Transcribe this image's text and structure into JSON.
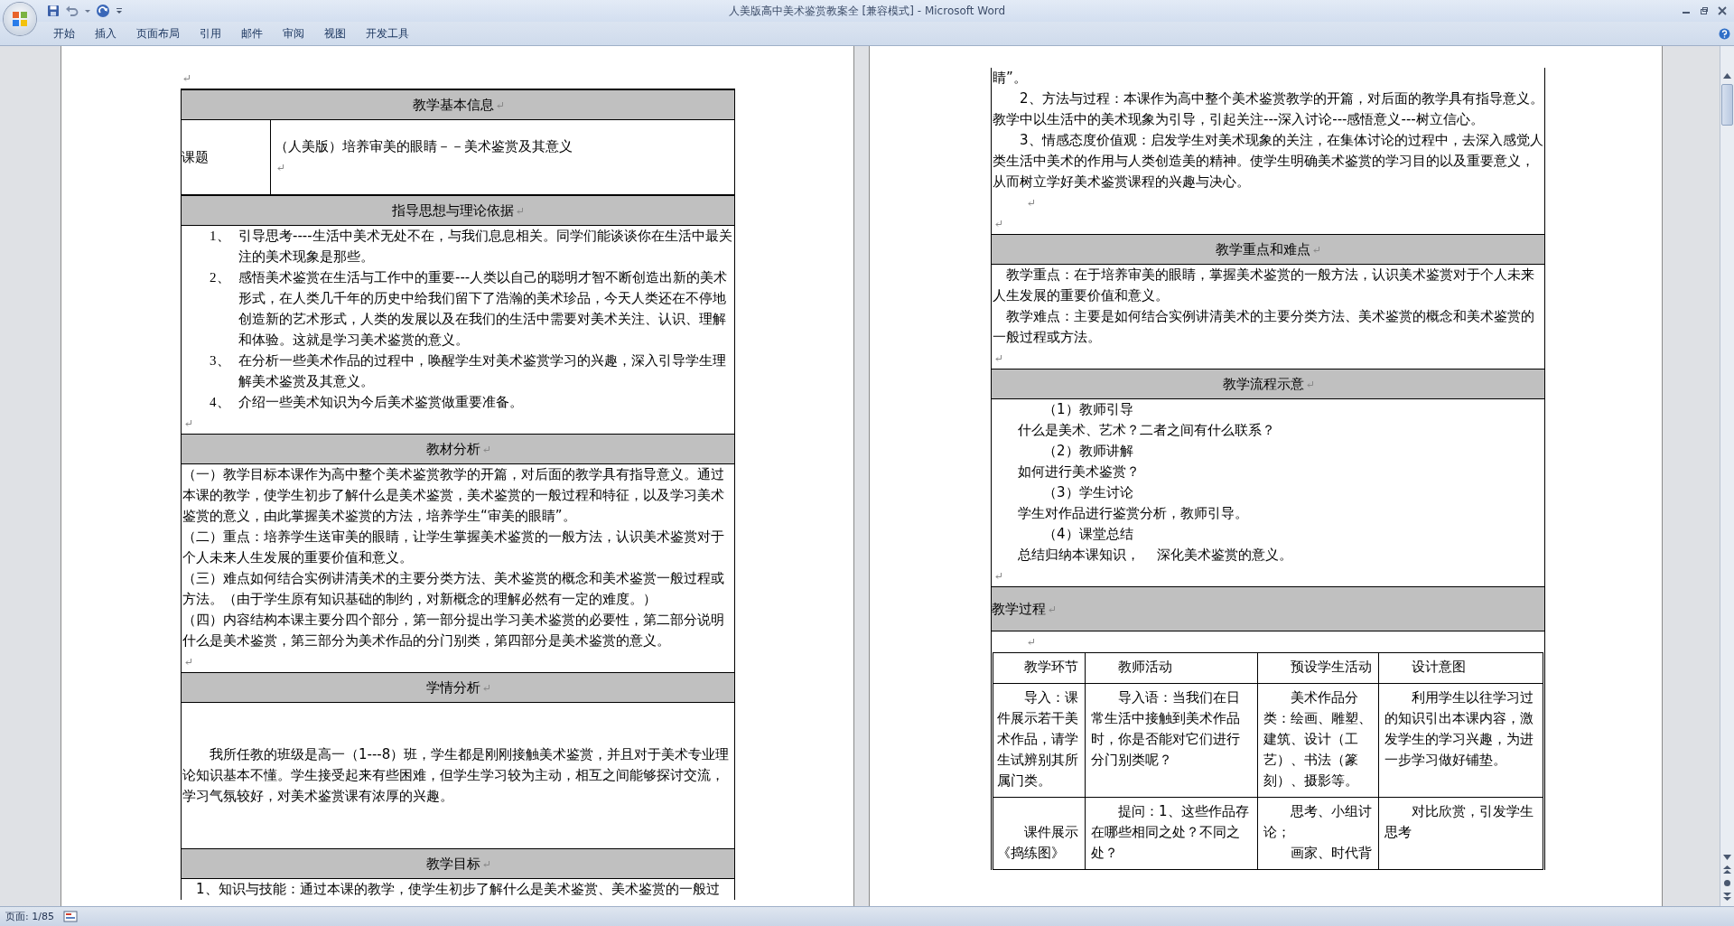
{
  "window": {
    "title": "人美版高中美术鉴赏教案全 [兼容模式] - Microsoft Word"
  },
  "ribbon_tabs": [
    {
      "label": "开始"
    },
    {
      "label": "插入"
    },
    {
      "label": "页面布局"
    },
    {
      "label": "引用"
    },
    {
      "label": "邮件"
    },
    {
      "label": "审阅"
    },
    {
      "label": "视图"
    },
    {
      "label": "开发工具"
    }
  ],
  "pages": [
    {
      "kind": "start",
      "sections": [
        {
          "kind": "header",
          "title": "教学基本信息"
        },
        {
          "kind": "label_row",
          "label": "课题",
          "paragraphs": [
            {
              "kind": "plain",
              "text": "（人美版）培养审美的眼睛－－美术鉴赏及其意义"
            },
            {
              "kind": "mark"
            }
          ]
        },
        {
          "kind": "header",
          "title": "指导思想与理论依据"
        },
        {
          "kind": "body",
          "paragraphs": [
            {
              "kind": "numbered",
              "number": "1、",
              "text": "引导思考----生活中美术无处不在，与我们息息相关。同学们能谈谈你在生活中最关注的美术现象是那些。"
            },
            {
              "kind": "numbered",
              "number": "2、",
              "text": "感悟美术鉴赏在生活与工作中的重要---人类以自己的聪明才智不断创造出新的美术形式，在人类几千年的历史中给我们留下了浩瀚的美术珍品，今天人类还在不停地创造新的艺术形式，人类的发展以及在我们的生活中需要对美术关注、认识、理解和体验。这就是学习美术鉴赏的意义。"
            },
            {
              "kind": "numbered",
              "number": "3、",
              "text": "在分析一些美术作品的过程中，唤醒学生对美术鉴赏学习的兴趣，深入引导学生理解美术鉴赏及其意义。"
            },
            {
              "kind": "numbered",
              "number": "4、",
              "text": "介绍一些美术知识为今后美术鉴赏做重要准备。"
            },
            {
              "kind": "mark"
            }
          ]
        },
        {
          "kind": "header",
          "title": "教材分析"
        },
        {
          "kind": "body",
          "paragraphs": [
            {
              "kind": "plain",
              "text": "（一）教学目标本课作为高中整个美术鉴赏教学的开篇，对后面的教学具有指导意义。通过本课的教学，使学生初步了解什么是美术鉴赏，美术鉴赏的一般过程和特征，以及学习美术鉴赏的意义，由此掌握美术鉴赏的方法，培养学生“审美的眼睛”。"
            },
            {
              "kind": "plain",
              "text": "（二）重点：培养学生送审美的眼睛，让学生掌握美术鉴赏的一般方法，认识美术鉴赏对于个人未来人生发展的重要价值和意义。"
            },
            {
              "kind": "plain",
              "text": "（三）难点如何结合实例讲清美术的主要分类方法、美术鉴赏的概念和美术鉴赏一般过程或方法。（由于学生原有知识基础的制约，对新概念的理解必然有一定的难度。）"
            },
            {
              "kind": "plain",
              "text": "（四）内容结构本课主要分四个部分，第一部分提出学习美术鉴赏的必要性，第二部分说明什么是美术鉴赏，第三部分为美术作品的分门别类，第四部分是美术鉴赏的意义。"
            },
            {
              "kind": "mark"
            }
          ]
        },
        {
          "kind": "header",
          "title": "学情分析"
        },
        {
          "kind": "body",
          "paragraphs": [
            {
              "kind": "gap"
            },
            {
              "kind": "gap"
            },
            {
              "kind": "first_line",
              "text": "我所任教的班级是高一（1---8）班，学生都是刚刚接触美术鉴赏，并且对于美术专业理论知识基本不懂。学生接受起来有些困难，但学生学习较为主动，相互之间能够探讨交流，学习气氛较好，对美术鉴赏课有浓厚的兴趣。"
            },
            {
              "kind": "gap"
            },
            {
              "kind": "gap"
            }
          ]
        },
        {
          "kind": "header",
          "title": "教学目标"
        },
        {
          "kind": "body",
          "paragraphs": [
            {
              "kind": "first_small",
              "text": "1、知识与技能：通过本课的教学，使学生初步了解什么是美术鉴赏、美术鉴赏的一般过"
            }
          ]
        }
      ]
    },
    {
      "kind": "continued",
      "sections": [
        {
          "kind": "body",
          "paragraphs": [
            {
              "kind": "plain",
              "text": "睛”。"
            },
            {
              "kind": "first_line",
              "text": "2、方法与过程：本课作为高中整个美术鉴赏教学的开篇，对后面的教学具有指导意义。教学中以生活中的美术现象为引导，引起关注---深入讨论---感悟意义---树立信心。"
            },
            {
              "kind": "first_line",
              "text": "3、情感态度价值观：启发学生对美术现象的关注，在集体讨论的过程中，去深入感觉人类生活中美术的作用与人类创造美的精神。使学生明确美术鉴赏的学习目的以及重要意义，从而树立学好美术鉴赏课程的兴趣与决心。"
            },
            {
              "kind": "indent_mark"
            },
            {
              "kind": "mark"
            }
          ]
        },
        {
          "kind": "header",
          "title": "教学重点和难点"
        },
        {
          "kind": "body",
          "paragraphs": [
            {
              "kind": "first_small",
              "text": "教学重点：在于培养审美的眼睛，掌握美术鉴赏的一般方法，认识美术鉴赏对于个人未来人生发展的重要价值和意义。"
            },
            {
              "kind": "first_small",
              "text": "教学难点：主要是如何结合实例讲清美术的主要分类方法、美术鉴赏的概念和美术鉴赏的一般过程或方法。"
            },
            {
              "kind": "mark"
            }
          ]
        },
        {
          "kind": "header",
          "title": "教学流程示意"
        },
        {
          "kind": "body",
          "paragraphs": [
            {
              "kind": "step",
              "text": "（1）教师引导"
            },
            {
              "kind": "hang",
              "text": "什么是美术、艺术？二者之间有什么联系？"
            },
            {
              "kind": "step",
              "text": "（2）教师讲解"
            },
            {
              "kind": "hang",
              "text": "如何进行美术鉴赏？"
            },
            {
              "kind": "step",
              "text": "（3）学生讨论"
            },
            {
              "kind": "hang",
              "text": "学生对作品进行鉴赏分析，教师引导。"
            },
            {
              "kind": "step",
              "text": "（4）课堂总结"
            },
            {
              "kind": "hang",
              "text": "总结归纳本课知识，    深化美术鉴赏的意义。"
            },
            {
              "kind": "mark"
            }
          ]
        },
        {
          "kind": "header_left",
          "title": "教学过程"
        },
        {
          "kind": "process",
          "paragraphs": [
            {
              "kind": "indent_mark"
            }
          ],
          "table": {
            "columns": [
              "教学环节",
              "教师活动",
              "预设学生活动",
              "设计意图"
            ],
            "rows": [
              {
                "cells": [
                  {
                    "paragraphs": [
                      {
                        "kind": "first_line",
                        "text": "导入：课件展示若干美术作品，请学生试辨别其所属门类。"
                      }
                    ]
                  },
                  {
                    "paragraphs": [
                      {
                        "kind": "first_line",
                        "text": "导入语：当我们在日常生活中接触到美术作品时，你是否能对它们进行分门别类呢？"
                      }
                    ]
                  },
                  {
                    "paragraphs": [
                      {
                        "kind": "first_line",
                        "text": "美术作品分类：绘画、雕塑、建筑、设计（工艺）、书法（篆刻）、摄影等。"
                      }
                    ]
                  },
                  {
                    "paragraphs": [
                      {
                        "kind": "first_line",
                        "text": "利用学生以往学习过的知识引出本课内容，激发学生的学习兴趣，为进一步学习做好铺垫。"
                      }
                    ]
                  }
                ]
              },
              {
                "cells": [
                  {
                    "paragraphs": [
                      {
                        "kind": "gap"
                      },
                      {
                        "kind": "first_line",
                        "text": "课件展示《捣练图》"
                      }
                    ]
                  },
                  {
                    "paragraphs": [
                      {
                        "kind": "first_line",
                        "text": "提问：1、这些作品存在哪些相同之处？不同之处？"
                      }
                    ]
                  },
                  {
                    "paragraphs": [
                      {
                        "kind": "first_line",
                        "text": "思考、小组讨论；"
                      },
                      {
                        "kind": "first_line",
                        "text": "画家、时代背"
                      }
                    ]
                  },
                  {
                    "paragraphs": [
                      {
                        "kind": "first_line",
                        "text": "对比欣赏，引发学生思考"
                      }
                    ]
                  }
                ]
              }
            ]
          }
        }
      ]
    }
  ],
  "status_bar": {
    "page": "页面: 1/85"
  }
}
